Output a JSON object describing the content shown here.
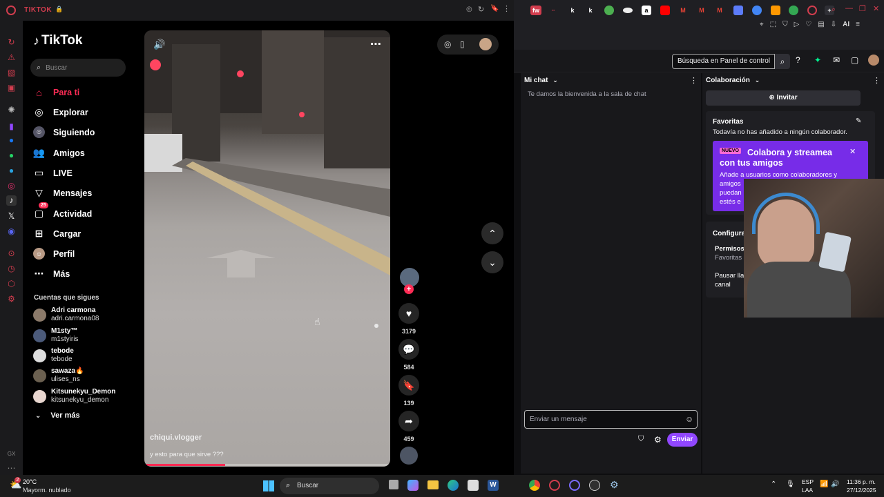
{
  "browser": {
    "tab_title": "TIKTOK",
    "toolbar_right": "AI"
  },
  "tiktok": {
    "logo": "TikTok",
    "search_placeholder": "Buscar",
    "nav": [
      {
        "label": "Para ti",
        "icon": "home-icon",
        "active": true
      },
      {
        "label": "Explorar",
        "icon": "compass-icon"
      },
      {
        "label": "Siguiendo",
        "icon": "following-icon"
      },
      {
        "label": "Amigos",
        "icon": "friends-icon"
      },
      {
        "label": "LIVE",
        "icon": "live-icon"
      },
      {
        "label": "Mensajes",
        "icon": "messages-icon"
      },
      {
        "label": "Actividad",
        "icon": "activity-icon",
        "badge": "25"
      },
      {
        "label": "Cargar",
        "icon": "upload-icon"
      },
      {
        "label": "Perfil",
        "icon": "profile-icon"
      },
      {
        "label": "Más",
        "icon": "more-icon"
      }
    ],
    "following_title": "Cuentas que sigues",
    "following": [
      {
        "name": "Adri carmona",
        "user": "adri.carmona08"
      },
      {
        "name": "M1sty™",
        "user": "m1styiris"
      },
      {
        "name": "tebode",
        "user": "tebode"
      },
      {
        "name": "sawaza🔥",
        "user": "ulises_ns"
      },
      {
        "name": "Kitsunekyu_Demon",
        "user": "kitsunekyu_demon"
      }
    ],
    "see_more": "Ver más",
    "video": {
      "author": "chiqui.vlogger",
      "caption": "y esto para que sirve ???",
      "likes": "3179",
      "comments": "584",
      "saves": "139",
      "shares": "459",
      "progress": 0.33
    }
  },
  "twitch": {
    "search_label": "Búsqueda en Panel de control",
    "chat_title": "Mi chat",
    "chat_welcome": "Te damos la bienvenida a la sala de chat",
    "chat_placeholder": "Enviar un mensaje",
    "send_button": "Enviar",
    "collab_title": "Colaboración",
    "invite_button": "Invitar",
    "favorites_title": "Favoritas",
    "favorites_empty": "Todavía no has añadido a ningún colaborador.",
    "promo_badge": "NUEVO",
    "promo_title": "Colabora y streamea con tus amigos",
    "promo_text_1": "Añade a usuarios como colaboradores y",
    "promo_text_2": "amigos",
    "promo_text_3": "puedan",
    "promo_text_4": "estés e",
    "config_title": "Configura",
    "perm_title": "Permisos",
    "perm_sub": "Favoritas",
    "pause_1": "Pausar lla",
    "pause_2": "canal",
    "accent": "#9147ff"
  },
  "taskbar": {
    "weather_temp": "20°C",
    "weather_desc": "Mayorm. nublado",
    "search": "Buscar",
    "lang_1": "ESP",
    "lang_2": "LAA",
    "time": "11:36 p. m.",
    "date": "27/12/2025",
    "badge": "2"
  }
}
